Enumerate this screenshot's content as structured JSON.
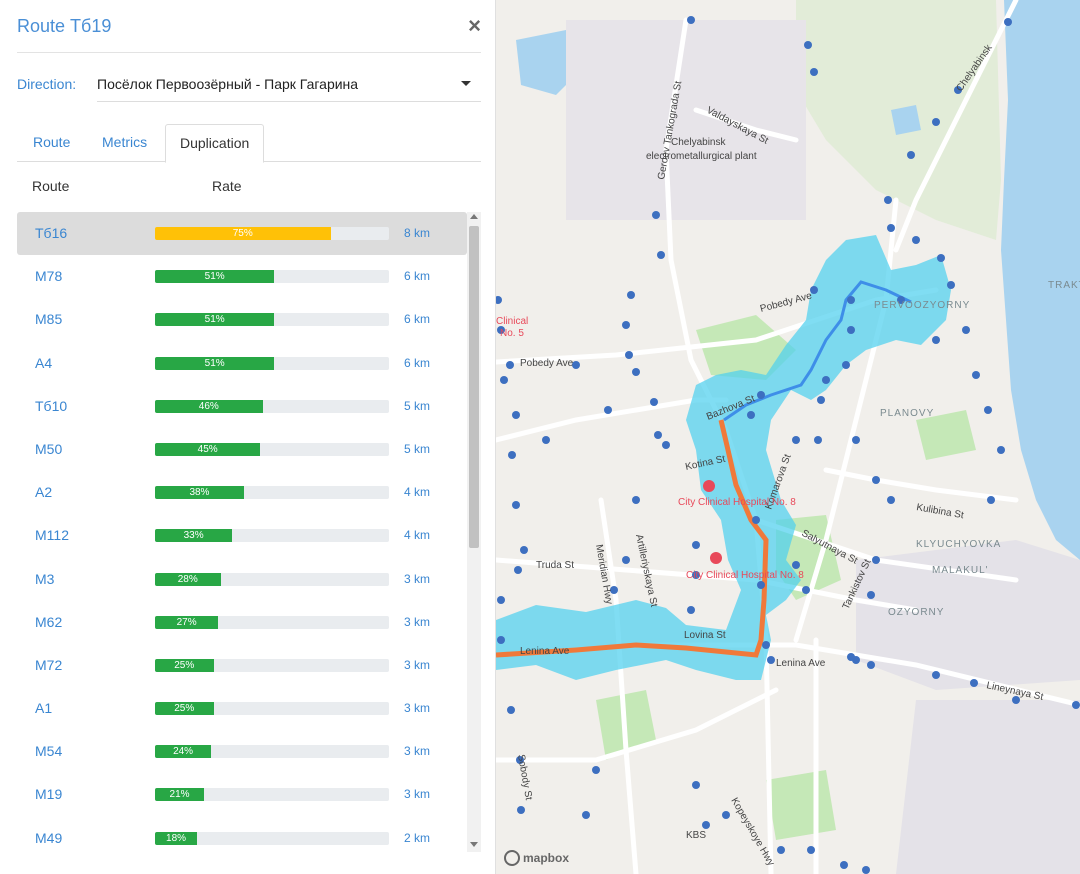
{
  "panel": {
    "title": "Route Тб19",
    "close_label": "×",
    "direction_label": "Direction:",
    "direction_value": "Посёлок Первоозёрный - Парк Гагарина",
    "tabs": [
      {
        "label": "Route",
        "active": false
      },
      {
        "label": "Metrics",
        "active": false
      },
      {
        "label": "Duplication",
        "active": true
      }
    ],
    "columns": {
      "route": "Route",
      "rate": "Rate"
    },
    "rows": [
      {
        "name": "Тб16",
        "pct": 75,
        "pct_label": "75%",
        "km": "8 km",
        "selected": true,
        "status": "warning"
      },
      {
        "name": "М78",
        "pct": 51,
        "pct_label": "51%",
        "km": "6 km"
      },
      {
        "name": "М85",
        "pct": 51,
        "pct_label": "51%",
        "km": "6 km"
      },
      {
        "name": "А4",
        "pct": 51,
        "pct_label": "51%",
        "km": "6 km"
      },
      {
        "name": "Тб10",
        "pct": 46,
        "pct_label": "46%",
        "km": "5 km"
      },
      {
        "name": "М50",
        "pct": 45,
        "pct_label": "45%",
        "km": "5 km"
      },
      {
        "name": "А2",
        "pct": 38,
        "pct_label": "38%",
        "km": "4 km"
      },
      {
        "name": "М112",
        "pct": 33,
        "pct_label": "33%",
        "km": "4 km"
      },
      {
        "name": "М3",
        "pct": 28,
        "pct_label": "28%",
        "km": "3 km"
      },
      {
        "name": "М62",
        "pct": 27,
        "pct_label": "27%",
        "km": "3 km"
      },
      {
        "name": "М72",
        "pct": 25,
        "pct_label": "25%",
        "km": "3 km"
      },
      {
        "name": "А1",
        "pct": 25,
        "pct_label": "25%",
        "km": "3 km"
      },
      {
        "name": "М54",
        "pct": 24,
        "pct_label": "24%",
        "km": "3 km"
      },
      {
        "name": "М19",
        "pct": 21,
        "pct_label": "21%",
        "km": "3 km"
      },
      {
        "name": "М49",
        "pct": 18,
        "pct_label": "18%",
        "km": "2 km"
      }
    ]
  },
  "map": {
    "streets": [
      "Valdayskaya St",
      "Geroev Tankograda St",
      "Pobedy Ave",
      "Bazhova St",
      "Kotina St",
      "Komarova St",
      "Salyutnaya St",
      "Truda St",
      "Meridian Hwy",
      "Artilleriyskaya St",
      "Lovina St",
      "Lenina Ave",
      "Lineynaya St",
      "Kulibina St",
      "Tankistov St",
      "Sobody St",
      "Kopeyskoye Hwy",
      "Chelyabinsk"
    ],
    "places": [
      "Chelyabinsk",
      "electrometallurgical plant",
      "City Clinical Hospital No. 8",
      "Clinical",
      "No. 5",
      "KBS"
    ],
    "districts": [
      "PERVOOZYORNY",
      "PLANOVY",
      "KLYUCHYOVKA",
      "MALAKUL'",
      "OZYORNY",
      "TRAKT"
    ],
    "attribution": "mapbox",
    "colors": {
      "water": "#a9d3ef",
      "park": "#c5e8b7",
      "land": "#f1efeb",
      "road": "#ffffff",
      "coverage": "#4fd0ef",
      "route_main": "#f0793a",
      "route_alt": "#3e8ee8",
      "stop": "#3d6fc0",
      "hospital": "#e8495a"
    }
  }
}
